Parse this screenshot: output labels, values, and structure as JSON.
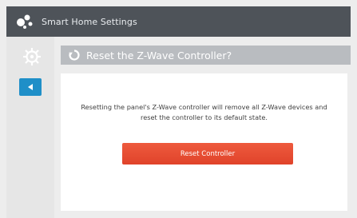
{
  "app": {
    "title": "Smart Home Settings",
    "accent": "#1f8fc8",
    "danger": "#e0432a"
  },
  "sidebar": {
    "settings_icon": "gear-icon",
    "back_icon": "back-arrow-icon"
  },
  "dialog": {
    "title": "Reset the Z-Wave Controller?",
    "title_icon": "refresh-icon",
    "message": "Resetting the panel's Z-Wave controller will remove all Z-Wave devices and reset the controller to its default state.",
    "action_label": "Reset Controller"
  }
}
